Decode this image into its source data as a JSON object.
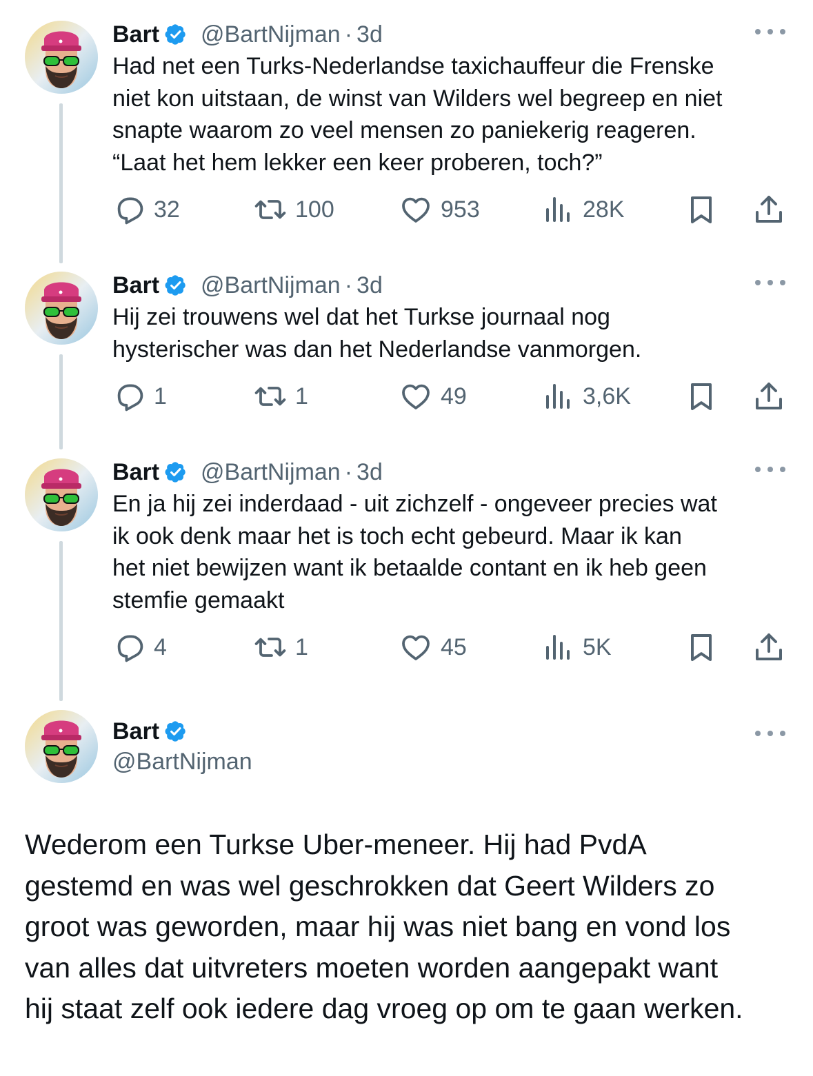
{
  "tweets": [
    {
      "name": "Bart",
      "handle": "@BartNijman",
      "separator": "·",
      "time": "3d",
      "lines": [
        "Had net een Turks-Nederlandse taxichauffeur die Frenske",
        "niet kon uitstaan, de winst van Wilders wel begreep en niet",
        "snapte waarom zo veel mensen zo paniekerig reageren.",
        "“Laat het hem lekker een keer proberen, toch?”"
      ],
      "replies": "32",
      "reposts": "100",
      "likes": "953",
      "views": "28K"
    },
    {
      "name": "Bart",
      "handle": "@BartNijman",
      "separator": "·",
      "time": "3d",
      "lines": [
        "Hij zei trouwens wel dat het Turkse journaal nog",
        "hysterischer was dan het Nederlandse vanmorgen."
      ],
      "replies": "1",
      "reposts": "1",
      "likes": "49",
      "views": "3,6K"
    },
    {
      "name": "Bart",
      "handle": "@BartNijman",
      "separator": "·",
      "time": "3d",
      "lines": [
        "En ja hij zei inderdaad - uit zichzelf - ongeveer precies wat",
        "ik ook denk maar het is toch echt gebeurd. Maar ik kan",
        "het niet bewijzen want ik betaalde contant en ik heb geen",
        "stemfie gemaakt"
      ],
      "replies": "4",
      "reposts": "1",
      "likes": "45",
      "views": "5K"
    }
  ],
  "main_tweet": {
    "name": "Bart",
    "handle": "@BartNijman",
    "lines": [
      "Wederom een Turkse Uber-meneer. Hij had PvdA",
      "gestemd en was wel geschrokken dat Geert Wilders zo",
      "groot was geworden, maar hij was niet bang en vond los",
      "van alles dat uitvreters moeten worden aangepakt want",
      "hij staat zelf ook iedere dag vroeg op om te gaan werken."
    ]
  },
  "colors": {
    "text": "#0f1419",
    "secondary": "#536471",
    "verified": "#1d9bf0",
    "thread_line": "#cfd9de"
  },
  "icons": [
    "reply-icon",
    "repost-icon",
    "like-icon",
    "views-icon",
    "bookmark-icon",
    "share-icon",
    "verified-badge-icon",
    "more-icon"
  ]
}
